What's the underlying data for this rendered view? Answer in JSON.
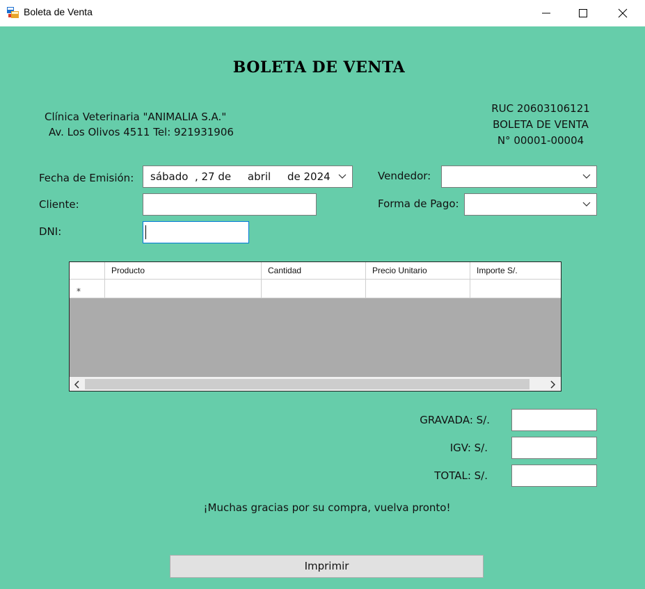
{
  "window": {
    "title": "Boleta de Venta",
    "controls": [
      "minimize",
      "maximize",
      "close"
    ]
  },
  "heading": "BOLETA DE VENTA",
  "company": {
    "name": "Clínica Veterinaria \"ANIMALIA S.A.\"",
    "address": "Av.  Los Olivos 4511  Tel: 921931906"
  },
  "document": {
    "ruc": "RUC 20603106121",
    "type": "BOLETA DE VENTA",
    "number": "N° 00001-00004"
  },
  "form": {
    "fecha_label": "Fecha de Emisión:",
    "fecha_value": "sábado  , 27 de     abril     de 2024",
    "cliente_label": "Cliente:",
    "cliente_value": "",
    "dni_label": "DNI:",
    "dni_value": "",
    "vendedor_label": "Vendedor:",
    "vendedor_value": "",
    "pago_label": "Forma de Pago:",
    "pago_value": ""
  },
  "grid": {
    "columns": [
      "Producto",
      "Cantidad",
      "Precio Unitario",
      "Importe S/."
    ],
    "new_row_marker": "*"
  },
  "totals": {
    "gravada_label": "GRAVADA: S/.",
    "igv_label": "IGV: S/.",
    "total_label": "TOTAL: S/.",
    "gravada_value": "",
    "igv_value": "",
    "total_value": ""
  },
  "footer": {
    "thanks": "¡Muchas gracias por su compra, vuelva pronto!",
    "print_label": "Imprimir"
  },
  "colors": {
    "background": "#66CDAA",
    "grid_empty": "#ABABAB"
  }
}
